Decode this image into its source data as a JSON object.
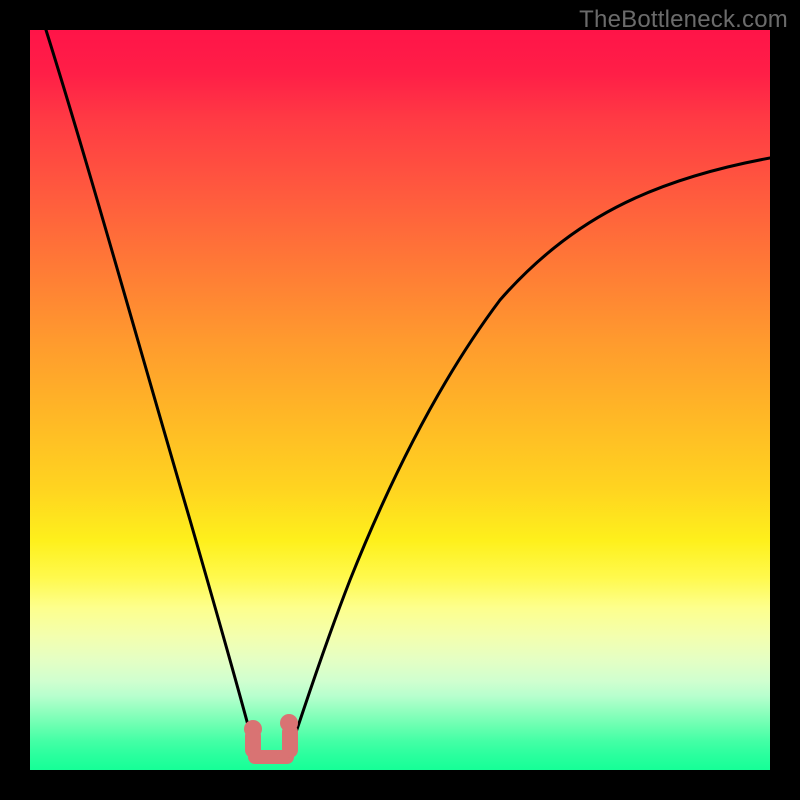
{
  "watermark": "TheBottleneck.com",
  "chart_data": {
    "type": "line",
    "title": "",
    "xlabel": "",
    "ylabel": "",
    "xlim": [
      0,
      100
    ],
    "ylim": [
      0,
      100
    ],
    "annotations": "Bottleneck curve: deep V-shaped mismatch profile. The left branch descends steeply from top-left to a minimum roughly at x≈30 (near-zero bottleneck), then a second branch rises with decreasing slope toward the right edge.",
    "series": [
      {
        "name": "left-branch",
        "x": [
          2,
          5,
          8,
          11,
          14,
          17,
          20,
          23,
          26,
          28,
          29.5,
          30.5
        ],
        "y": [
          100,
          92,
          84,
          76,
          67,
          58,
          48,
          37,
          24,
          13,
          6,
          2
        ]
      },
      {
        "name": "right-branch",
        "x": [
          34,
          36,
          40,
          45,
          50,
          55,
          60,
          65,
          70,
          75,
          80,
          85,
          90,
          95,
          100
        ],
        "y": [
          2,
          8,
          19,
          31,
          41,
          49,
          56,
          61,
          66,
          70,
          73,
          76,
          78.5,
          80.5,
          82
        ]
      }
    ],
    "optimal_marker": {
      "x_range": [
        29,
        35
      ],
      "y": 1.5,
      "shape": "U",
      "color": "#d97373"
    },
    "background_gradient": {
      "top": "#ff1448",
      "mid": "#ffd420",
      "bottom": "#16ff97"
    }
  }
}
